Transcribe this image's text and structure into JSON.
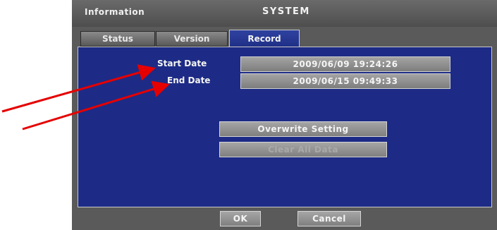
{
  "window": {
    "section_label": "Information",
    "title": "SYSTEM"
  },
  "tabs": [
    {
      "label": "Status",
      "active": false
    },
    {
      "label": "Version",
      "active": false
    },
    {
      "label": "Record",
      "active": true
    }
  ],
  "record": {
    "start_date_label": "Start Date",
    "start_date_value": "2009/06/09  19:24:26",
    "end_date_label": "End Date",
    "end_date_value": "2009/06/15  09:49:33",
    "overwrite_button": "Overwrite Setting",
    "clear_button": "Clear All Data"
  },
  "footer": {
    "ok_label": "OK",
    "cancel_label": "Cancel"
  },
  "colors": {
    "panel": "#1d2b86",
    "annotation_arrow": "#e60000"
  }
}
